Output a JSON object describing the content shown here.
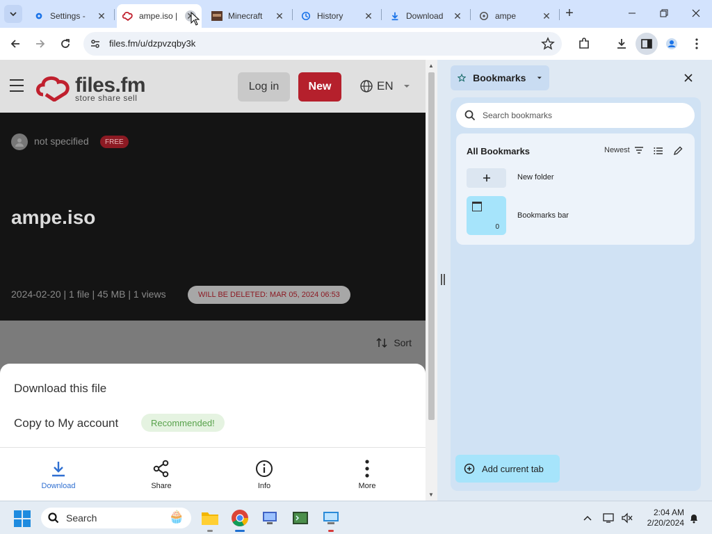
{
  "browser": {
    "tabs": [
      {
        "title": "Settings - ",
        "favicon": "gear-icon",
        "active": false
      },
      {
        "title": "ampe.iso | ",
        "favicon": "filesfm-icon",
        "active": true
      },
      {
        "title": "Minecraft ",
        "favicon": "minecraft-icon",
        "active": false
      },
      {
        "title": "History",
        "favicon": "history-icon",
        "active": false
      },
      {
        "title": "Download",
        "favicon": "download-icon",
        "active": false
      },
      {
        "title": "ampe",
        "favicon": "globe-icon",
        "active": false
      }
    ],
    "url": "files.fm/u/dzpvzqby3k"
  },
  "site": {
    "brand": "files.fm",
    "tagline": "store share sell",
    "login_label": "Log in",
    "new_label": "New",
    "language": "EN",
    "owner": "not specified",
    "free_badge": "FREE",
    "filename": "ampe.iso",
    "meta": "2024-02-20 | 1 file | 45 MB | 1 views",
    "delete_notice": "WILL BE DELETED: MAR 05, 2024 06:53",
    "sort_label": "Sort",
    "sheet": {
      "download_this_file": "Download this file",
      "copy_to_account": "Copy to My account",
      "recommended": "Recommended!"
    },
    "bottom_nav": [
      {
        "label": "Download",
        "icon": "download-icon",
        "active": true
      },
      {
        "label": "Share",
        "icon": "share-icon",
        "active": false
      },
      {
        "label": "Info",
        "icon": "info-icon",
        "active": false
      },
      {
        "label": "More",
        "icon": "more-vert-icon",
        "active": false
      }
    ]
  },
  "bookmarks_panel": {
    "title": "Bookmarks",
    "search_placeholder": "Search bookmarks",
    "section_title": "All Bookmarks",
    "sort_label": "Newest",
    "new_folder_label": "New folder",
    "bookmarks_bar_label": "Bookmarks bar",
    "bookmarks_bar_count": "0",
    "add_current_tab": "Add current tab"
  },
  "taskbar": {
    "search_label": "Search",
    "time": "2:04 AM",
    "date": "2/20/2024"
  },
  "colors": {
    "brand_red": "#b5202c",
    "accent_blue": "#2f6fd1",
    "panel_bg": "#d0e2f4",
    "tabstrip_bg": "#d3e3fd"
  }
}
